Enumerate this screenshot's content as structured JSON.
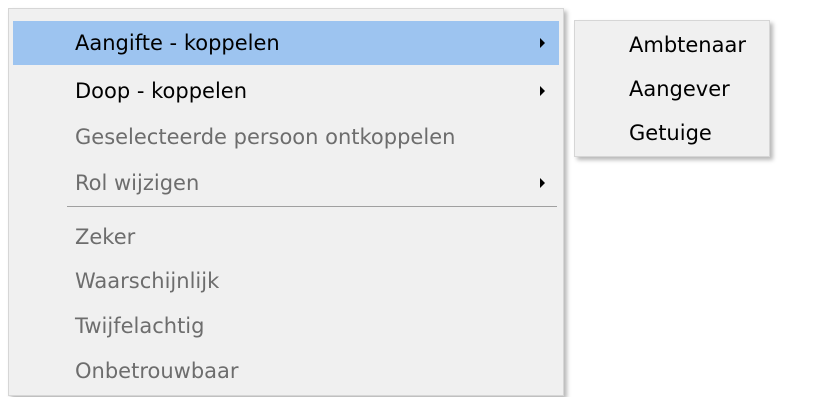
{
  "context_menu": {
    "items": [
      {
        "label": "Aangifte - koppelen",
        "enabled": true,
        "has_submenu": true,
        "highlighted": true
      },
      {
        "label": "Doop - koppelen",
        "enabled": true,
        "has_submenu": true,
        "highlighted": false
      },
      {
        "label": "Geselecteerde persoon ontkoppelen",
        "enabled": false,
        "has_submenu": false,
        "highlighted": false
      },
      {
        "label": "Rol wijzigen",
        "enabled": false,
        "has_submenu": true,
        "highlighted": false
      }
    ],
    "certainty_items": [
      {
        "label": "Zeker",
        "enabled": false
      },
      {
        "label": "Waarschijnlijk",
        "enabled": false
      },
      {
        "label": "Twijfelachtig",
        "enabled": false
      },
      {
        "label": "Onbetrouwbaar",
        "enabled": false
      }
    ]
  },
  "submenu": {
    "items": [
      {
        "label": "Ambtenaar"
      },
      {
        "label": "Aangever"
      },
      {
        "label": "Getuige"
      }
    ]
  },
  "colors": {
    "menu_background": "#f0f0f0",
    "highlight": "#9dc4f0",
    "disabled_text": "#6d6d6d",
    "enabled_text": "#000000"
  }
}
